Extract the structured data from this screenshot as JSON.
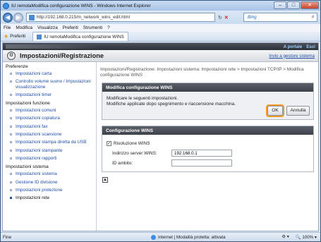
{
  "window": {
    "title": "IU remotaModifica configurazione WINS",
    "title_suffix": "- Windows Internet Explorer",
    "controls": [
      "–",
      "□",
      "✕"
    ]
  },
  "address": {
    "url": "http://192.168.0.215/m_network_wins_edit.html",
    "search_placeholder": "Bing"
  },
  "menu": [
    "File",
    "Modifica",
    "Visualizza",
    "Preferiti",
    "Strumenti",
    "?"
  ],
  "favorites": {
    "label": "Preferiti",
    "tab_title": "IU remotaModifica configurazione WINS"
  },
  "header": {
    "portal_link": "A portale",
    "logout_link": "Esci",
    "title": "Impostazioni/Registrazione",
    "admin_link": "Invio a gestore sistema"
  },
  "sidebar": {
    "sections": [
      {
        "title": "Preferenze",
        "items": [
          {
            "label": "Impostazioni carta"
          },
          {
            "label": "Controllo volume suono / Impostazioni visualizzazione"
          },
          {
            "label": "Impostazioni timer"
          }
        ]
      },
      {
        "title": "Impostazioni funzione",
        "items": [
          {
            "label": "Impostazioni comuni"
          },
          {
            "label": "Impostazioni copiatura"
          },
          {
            "label": "Impostazioni fax"
          },
          {
            "label": "Impostazioni scansione"
          },
          {
            "label": "Impostazioni stampa diretta da USB"
          },
          {
            "label": "Impostazioni stampante"
          },
          {
            "label": "Impostazioni rapporti"
          }
        ]
      },
      {
        "title": "Impostazioni sistema",
        "items": [
          {
            "label": "Impostazioni sistema"
          },
          {
            "label": "Gestione ID divisione"
          },
          {
            "label": "Impostazioni protezione"
          },
          {
            "label": "Impostazioni rete"
          }
        ]
      }
    ]
  },
  "main": {
    "breadcrumb": "Impostazioni/Registrazione: Impostazioni sistema: Impostazioni rete > Impostazioni TCP/IP > Modifica configurazione WINS",
    "dialog": {
      "title": "Modifica configurazione WINS",
      "line1": "Modificare le seguenti impostazioni.",
      "line2": "Modifiche applicate dopo spegnimento e riaccensione macchina.",
      "ok_label": "OK",
      "cancel_label": "Annulla"
    },
    "wins": {
      "title": "Configurazione WINS",
      "resolution_label": "Risoluzione WINS",
      "resolution_checked": "✓",
      "server_label": "Indirizzo server WINS:",
      "server_value": "192.168.0.1",
      "scope_label": "ID ambito:",
      "scope_value": ""
    }
  },
  "status": {
    "left": "Fine",
    "zone": "Internet | Modalità protetta: attivata",
    "zoom": "100%"
  }
}
